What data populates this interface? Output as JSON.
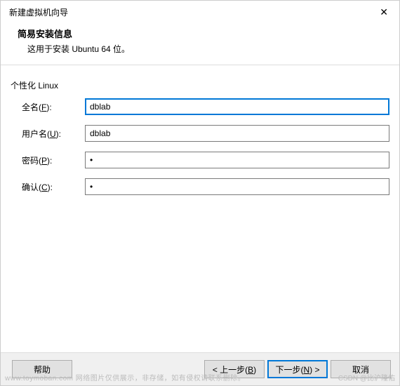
{
  "window": {
    "title": "新建虚拟机向导",
    "close_glyph": "✕"
  },
  "header": {
    "heading": "简易安装信息",
    "subheading": "这用于安装 Ubuntu 64 位。"
  },
  "section_label": "个性化 Linux",
  "form": {
    "fullname": {
      "label_pre": "全名(",
      "label_key": "F",
      "label_post": "):",
      "value": "dblab"
    },
    "username": {
      "label_pre": "用户名(",
      "label_key": "U",
      "label_post": "):",
      "value": "dblab"
    },
    "password": {
      "label_pre": "密码(",
      "label_key": "P",
      "label_post": "):",
      "value": "•"
    },
    "confirm": {
      "label_pre": "确认(",
      "label_key": "C",
      "label_post": "):",
      "value": "•"
    }
  },
  "footer": {
    "help": "帮助",
    "back_pre": "< 上一步(",
    "back_key": "B",
    "back_post": ")",
    "next_pre": "下一步(",
    "next_key": "N",
    "next_post": ") >",
    "cancel": "取消"
  },
  "watermark": "www.toymoban.com 网络图片仅供展示，非存储，如有侵权请联系删除。",
  "watermark2": "CSDN @比沪隆佑"
}
